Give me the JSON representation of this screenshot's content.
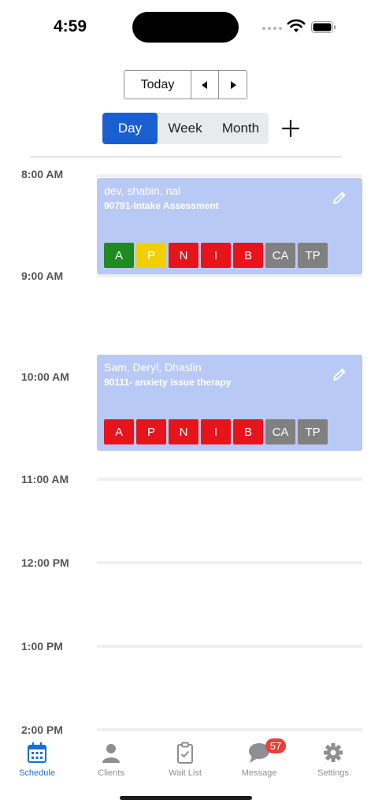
{
  "status": {
    "time": "4:59"
  },
  "nav": {
    "today_label": "Today"
  },
  "view_modes": [
    {
      "label": "Day",
      "active": true
    },
    {
      "label": "Week",
      "active": false
    },
    {
      "label": "Month",
      "active": false
    }
  ],
  "hours": [
    "8:00 AM",
    "9:00 AM",
    "10:00 AM",
    "11:00 AM",
    "12:00 PM",
    "1:00 PM",
    "2:00 PM"
  ],
  "events": [
    {
      "title": "dev, shabin, nal",
      "subtitle": "90791-Intake Assessment",
      "chips": [
        {
          "label": "A",
          "color": "#1f8a1f"
        },
        {
          "label": "P",
          "color": "#f2d000"
        },
        {
          "label": "N",
          "color": "#e8141b"
        },
        {
          "label": "I",
          "color": "#e8141b"
        },
        {
          "label": "B",
          "color": "#e8141b"
        },
        {
          "label": "CA",
          "color": "#808080"
        },
        {
          "label": "TP",
          "color": "#808080"
        }
      ]
    },
    {
      "title": "Sam, Deryl, Dhaslin",
      "subtitle": "90111- anxiety issue therapy",
      "chips": [
        {
          "label": "A",
          "color": "#e8141b"
        },
        {
          "label": "P",
          "color": "#e8141b"
        },
        {
          "label": "N",
          "color": "#e8141b"
        },
        {
          "label": "I",
          "color": "#e8141b"
        },
        {
          "label": "B",
          "color": "#e8141b"
        },
        {
          "label": "CA",
          "color": "#808080"
        },
        {
          "label": "TP",
          "color": "#808080"
        }
      ]
    }
  ],
  "tabs": [
    {
      "label": "Schedule",
      "icon": "calendar-icon",
      "active": true
    },
    {
      "label": "Clients",
      "icon": "person-icon",
      "active": false
    },
    {
      "label": "Wait List",
      "icon": "clipboard-icon",
      "active": false
    },
    {
      "label": "Message",
      "icon": "chat-bubble-icon",
      "active": false,
      "badge": "57"
    },
    {
      "label": "Settings",
      "icon": "gear-icon",
      "active": false
    }
  ],
  "colors": {
    "accent": "#1a5fd0",
    "event_background": "#b9c9f5",
    "badge": "#e8403a"
  }
}
